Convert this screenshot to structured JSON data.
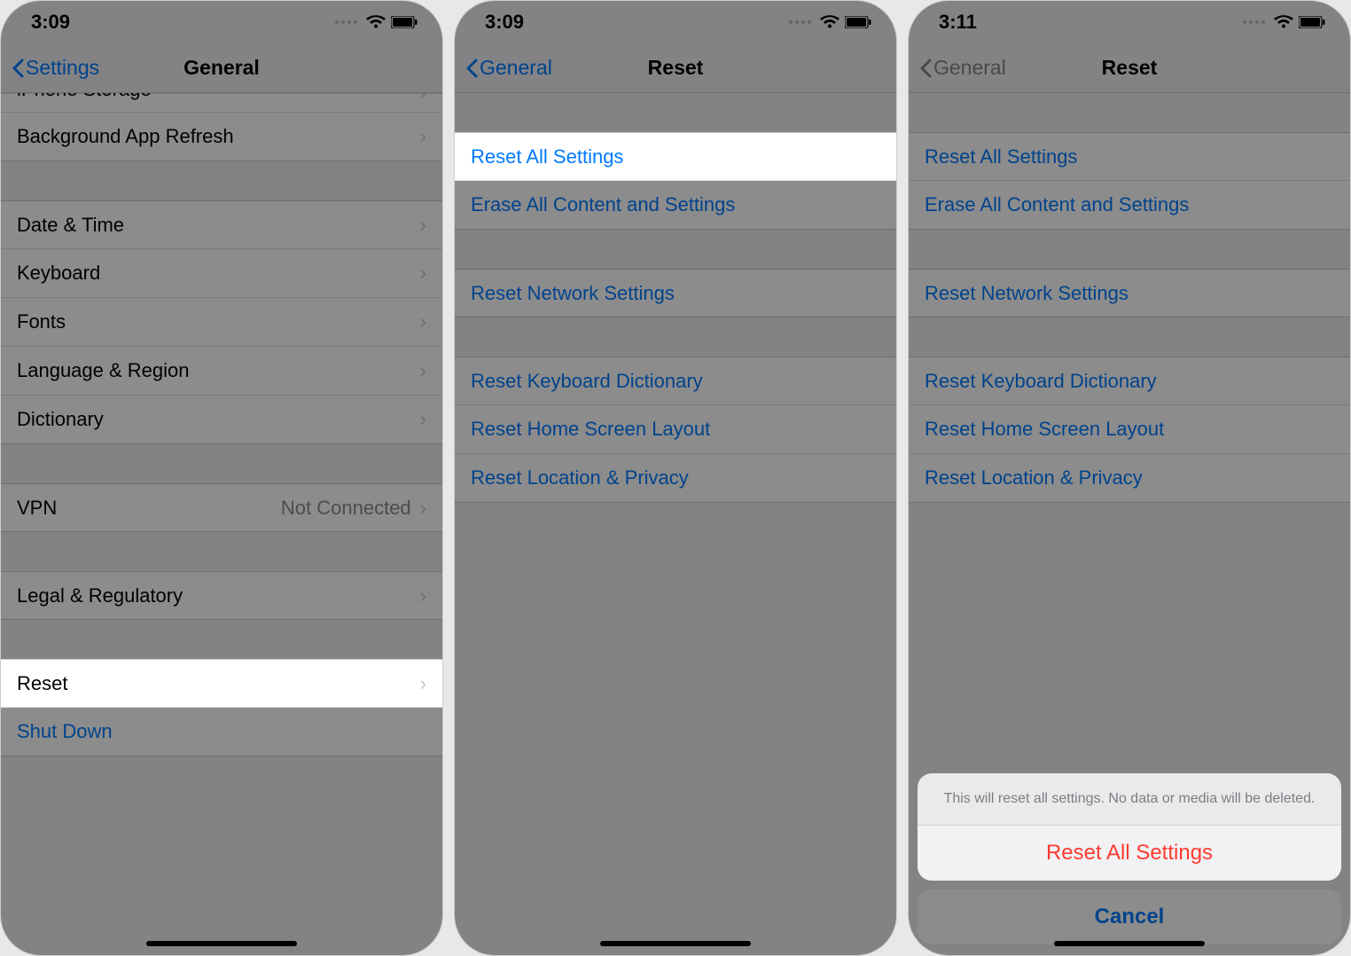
{
  "screens": {
    "s1": {
      "time": "3:09",
      "back": "Settings",
      "title": "General",
      "rows": {
        "storage": "iPhone Storage",
        "bgrefresh": "Background App Refresh",
        "datetime": "Date & Time",
        "keyboard": "Keyboard",
        "fonts": "Fonts",
        "langregion": "Language & Region",
        "dictionary": "Dictionary",
        "vpn": "VPN",
        "vpn_val": "Not Connected",
        "legal": "Legal & Regulatory",
        "reset": "Reset",
        "shutdown": "Shut Down"
      }
    },
    "s2": {
      "time": "3:09",
      "back": "General",
      "title": "Reset",
      "rows": {
        "reset_all": "Reset All Settings",
        "erase": "Erase All Content and Settings",
        "network": "Reset Network Settings",
        "keyboard_dict": "Reset Keyboard Dictionary",
        "home_layout": "Reset Home Screen Layout",
        "loc_priv": "Reset Location & Privacy"
      }
    },
    "s3": {
      "time": "3:11",
      "back": "General",
      "title": "Reset",
      "rows": {
        "reset_all": "Reset All Settings",
        "erase": "Erase All Content and Settings",
        "network": "Reset Network Settings",
        "keyboard_dict": "Reset Keyboard Dictionary",
        "home_layout": "Reset Home Screen Layout",
        "loc_priv": "Reset Location & Privacy"
      },
      "sheet": {
        "msg": "This will reset all settings. No data or media will be deleted.",
        "confirm": "Reset All Settings",
        "cancel": "Cancel"
      }
    }
  }
}
